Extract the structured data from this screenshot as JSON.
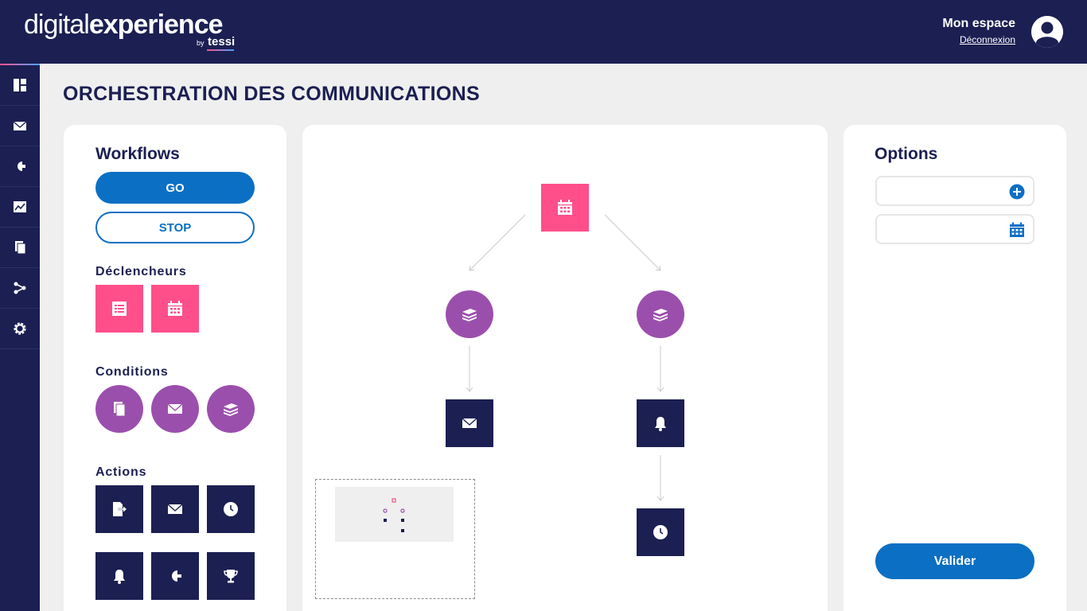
{
  "brand": {
    "light": "digital",
    "bold": "experience",
    "by": "by",
    "company": "tessi"
  },
  "user": {
    "space_label": "Mon espace",
    "logout_label": "Déconnexion"
  },
  "sidebar": {
    "items": [
      "dashboard-icon",
      "mail-icon",
      "plug-icon",
      "chart-icon",
      "documents-icon",
      "share-icon",
      "gear-icon"
    ]
  },
  "page": {
    "title": "ORCHESTRATION DES COMMUNICATIONS"
  },
  "workflows": {
    "heading": "Workflows",
    "go_label": "GO",
    "stop_label": "STOP",
    "triggers_label": "Déclencheurs",
    "triggers": [
      "form-list-icon",
      "calendar-icon"
    ],
    "conditions_label": "Conditions",
    "conditions": [
      "documents-icon",
      "mail-icon",
      "stack-icon"
    ],
    "actions_label": "Actions",
    "actions": [
      "export-icon",
      "mail-icon",
      "clock-icon",
      "bell-icon",
      "plug-icon",
      "trophy-icon"
    ]
  },
  "canvas": {
    "nodes": [
      {
        "name": "trigger-calendar",
        "icon": "calendar-icon"
      },
      {
        "name": "condition-stack-left",
        "icon": "stack-icon"
      },
      {
        "name": "condition-stack-right",
        "icon": "stack-icon"
      },
      {
        "name": "action-mail",
        "icon": "mail-icon"
      },
      {
        "name": "action-bell",
        "icon": "bell-icon"
      },
      {
        "name": "action-clock",
        "icon": "clock-icon"
      }
    ]
  },
  "options": {
    "heading": "Options",
    "field1_placeholder": "",
    "field2_placeholder": "",
    "submit_label": "Valider"
  },
  "colors": {
    "navy": "#1b1f52",
    "blue": "#0b6fc4",
    "pink": "#ff4f8b",
    "purple": "#9b4fad",
    "background": "#efefef"
  }
}
